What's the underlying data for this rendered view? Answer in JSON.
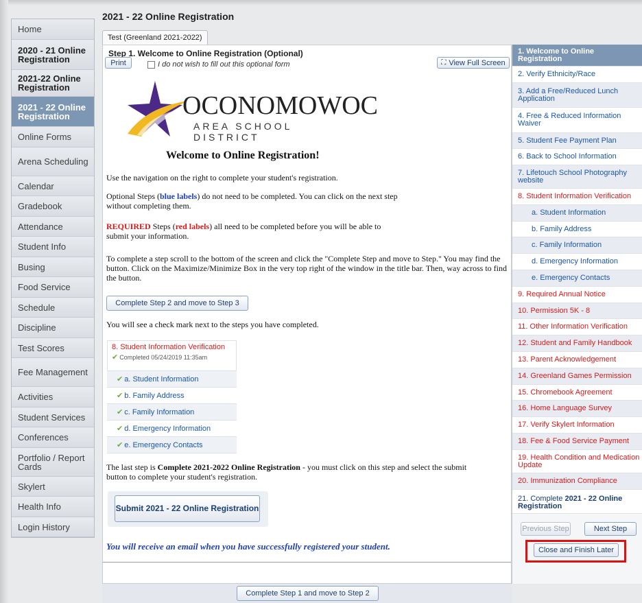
{
  "page_title": "2021 - 22 Online Registration",
  "tab_label": "Test (Greenland 2021-2022)",
  "left_nav": [
    {
      "label": "Home"
    },
    {
      "label": "2020 - 21 Online Registration"
    },
    {
      "label": "2021-22 Online Registration"
    },
    {
      "label": "2021 - 22 Online Registration"
    },
    {
      "label": "Online Forms"
    },
    {
      "label": "Arena Scheduling"
    },
    {
      "label": "Calendar"
    },
    {
      "label": "Gradebook"
    },
    {
      "label": "Attendance"
    },
    {
      "label": "Student Info"
    },
    {
      "label": "Busing"
    },
    {
      "label": "Food Service"
    },
    {
      "label": "Schedule"
    },
    {
      "label": "Discipline"
    },
    {
      "label": "Test Scores"
    },
    {
      "label": "Fee Management"
    },
    {
      "label": "Activities"
    },
    {
      "label": "Student Services"
    },
    {
      "label": "Conferences"
    },
    {
      "label": "Portfolio / Report Cards"
    },
    {
      "label": "Skylert"
    },
    {
      "label": "Health Info"
    },
    {
      "label": "Login History"
    }
  ],
  "content": {
    "step_title": "Step 1. Welcome to Online Registration (Optional)",
    "print_label": "Print",
    "optional_checkbox_label": "I do not wish to fill out this optional form",
    "full_screen_label": "View Full Screen",
    "logo": {
      "name": "OCONOMOWOC",
      "sub": "AREA SCHOOL DISTRICT"
    },
    "welcome": "Welcome to Online Registration!",
    "nav_text": "Use the navigation on the right to complete your student's registration.",
    "optional_pre": "Optional Steps (",
    "optional_label": "blue labels",
    "optional_post": ") do not need to be completed.  You can click on the next step without completing them.",
    "required_label": "REQUIRED",
    "required_mid": " Steps (",
    "required_red": "red labels",
    "required_post": ")  all need to be completed before you will be able to submit your information.",
    "scroll_text": "To complete a step scroll to the bottom of the screen and click the \"Complete Step and move to Step.\" You may find the button. Click on the Maximize/Minimize Box in the very top right of the window in the title bar. Then, way across to find the button.",
    "complete_step2_label": "Complete Step 2 and move to Step 3",
    "check_mark_text": "You will see a check mark next to the steps you have completed.",
    "example": {
      "title": "8. Student Information Verification",
      "completed": "Completed 05/24/2019 11:35am",
      "items": [
        "a. Student Information",
        "b. Family Address",
        "c. Family Information",
        "d. Emergency Information",
        "e. Emergency Contacts"
      ]
    },
    "last_step_pre": "The last step is ",
    "last_step_bold": "Complete 2021-2022 Online Registration",
    "last_step_post": " - you must click on this step and select the submit button to complete your student's registration.",
    "submit_label": "Submit 2021 - 22 Online Registration",
    "email_msg": "You will receive an email when you have successfully registered your student.",
    "complete_step1_label": "Complete Step 1 and move to Step 2"
  },
  "steps": [
    {
      "label": "1. Welcome to Online Registration"
    },
    {
      "label": "2. Verify Ethnicity/Race"
    },
    {
      "label": "3. Add a Free/Reduced Lunch Application"
    },
    {
      "label": "4. Free & Reduced Information Waiver"
    },
    {
      "label": "5. Student Fee Payment Plan"
    },
    {
      "label": "6. Back to School Information"
    },
    {
      "label": "7. Lifetouch School Photography website"
    },
    {
      "label": "8. Student Information Verification"
    },
    {
      "label": "a. Student Information"
    },
    {
      "label": "b. Family Address"
    },
    {
      "label": "c. Family Information"
    },
    {
      "label": "d. Emergency Information"
    },
    {
      "label": "e. Emergency Contacts"
    },
    {
      "label": "9. Required Annual Notice"
    },
    {
      "label": "10. Permission 5K - 8"
    },
    {
      "label": "11. Other Information Verification"
    },
    {
      "label": "12. Student and Family Handbook"
    },
    {
      "label": "13. Parent Acknowledgement"
    },
    {
      "label": "14. Greenland Games Permission"
    },
    {
      "label": "15. Chromebook Agreement"
    },
    {
      "label": "16. Home Language Survey"
    },
    {
      "label": "17. Verify Skylert Information"
    },
    {
      "label": "18. Fee & Food Service Payment"
    },
    {
      "label": "19. Health Condition and Medication Update"
    },
    {
      "label": "20. Immunization Compliance"
    },
    {
      "label_pre": "21. Complete ",
      "label_bold": "2021 - 22 Online Registration"
    }
  ],
  "previous_step_label": "Previous Step",
  "next_step_label": "Next Step",
  "close_later_label": "Close and Finish Later",
  "colors": {
    "active_nav": "#7d96b4",
    "required_red": "#d41b1b",
    "optional_blue": "#1b56a8",
    "highlight_red": "#e01010"
  }
}
